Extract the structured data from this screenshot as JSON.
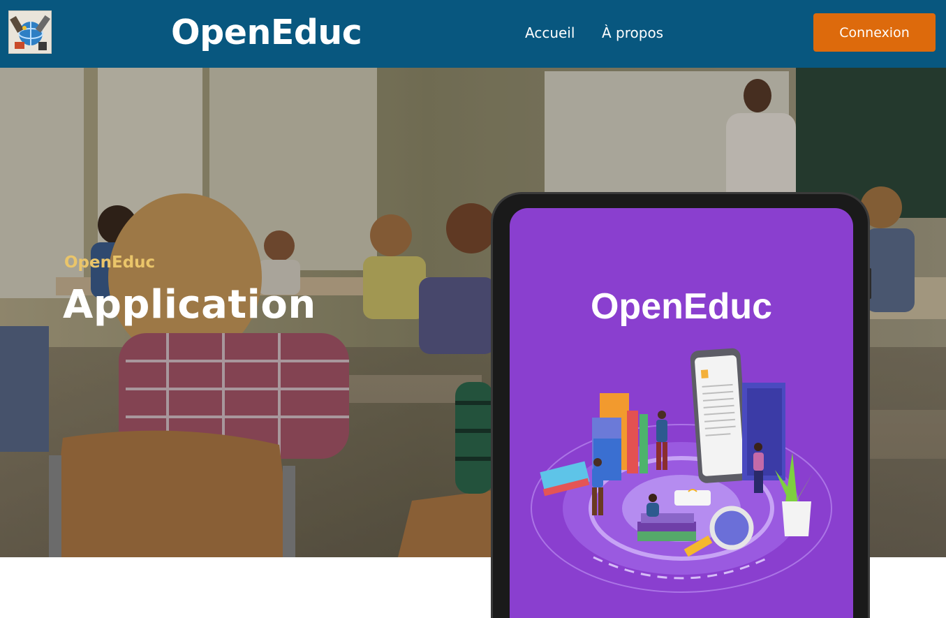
{
  "header": {
    "logo_icon": "globe-tools-icon",
    "brand": "OpenEduc",
    "nav": [
      {
        "label": "Accueil"
      },
      {
        "label": "À propos"
      }
    ],
    "login_label": "Connexion"
  },
  "hero": {
    "kicker": "OpenEduc",
    "title": "Application",
    "background": "classroom-photo"
  },
  "tablet": {
    "screen_title": "OpenEduc",
    "illustration": "education-isometric-illustration"
  },
  "colors": {
    "header_bg": "#08577f",
    "login_bg": "#dd6a0c",
    "kicker": "#eac56a",
    "screen_bg": "#8a3fcf"
  }
}
